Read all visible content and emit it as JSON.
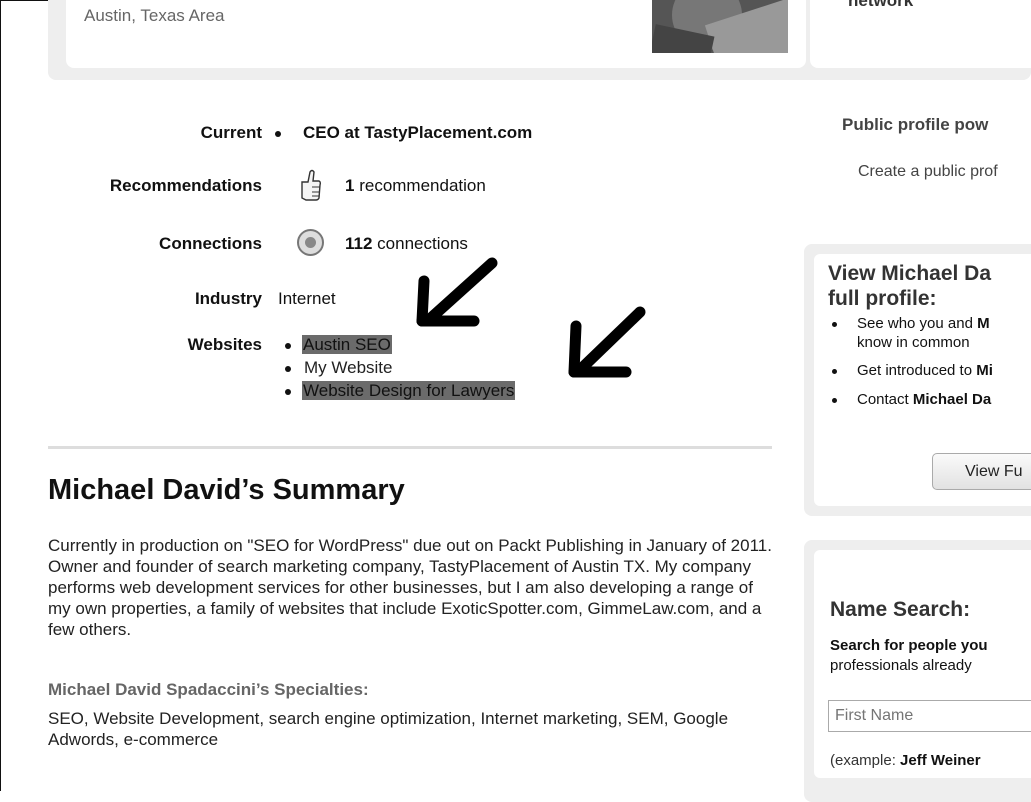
{
  "header": {
    "location": "Austin, Texas Area",
    "network_text": "network"
  },
  "profile": {
    "current_label": "Current",
    "current_value": "CEO at TastyPlacement.com",
    "recommendations_label": "Recommendations",
    "recommendations_count": "1",
    "recommendations_text": "recommendation",
    "connections_label": "Connections",
    "connections_count": "112",
    "connections_text": "connections",
    "industry_label": "Industry",
    "industry_value": "Internet",
    "websites_label": "Websites",
    "websites": [
      "Austin SEO",
      "My Website",
      "Website Design for Lawyers"
    ]
  },
  "summary": {
    "title": "Michael David’s Summary",
    "text": "Currently in production on \"SEO for WordPress\" due out on Packt Publishing in January of 2011. Owner and founder of search marketing company, TastyPlacement of Austin TX. My company performs web development services for other businesses, but I am also developing a range of my own properties, a family of websites that include ExoticSpotter.com, GimmeLaw.com, and a few others.",
    "specialties_title": "Michael David Spadaccini’s Specialties:",
    "specialties_text": "SEO, Website Development, search engine optimization, Internet marketing, SEM, Google Adwords, e-commerce"
  },
  "sidebar": {
    "public_title": "Public profile pow",
    "public_text": "Create a public prof",
    "full_profile": {
      "title_line1": "View Michael Da",
      "title_line2": "full profile:",
      "item1_pre": "See who you and ",
      "item1_bold": "M",
      "item1_line2": "know in common",
      "item2_pre": "Get introduced to ",
      "item2_bold": "Mi",
      "item3_pre": "Contact ",
      "item3_bold": "Michael Da",
      "button_label": "View Fu"
    },
    "name_search": {
      "title": "Name Search:",
      "bold_line": "Search for people you",
      "sub_line": "professionals already",
      "first_name_placeholder": "First Name",
      "example_pre": "(example: ",
      "example_bold": "Jeff Weiner"
    }
  }
}
